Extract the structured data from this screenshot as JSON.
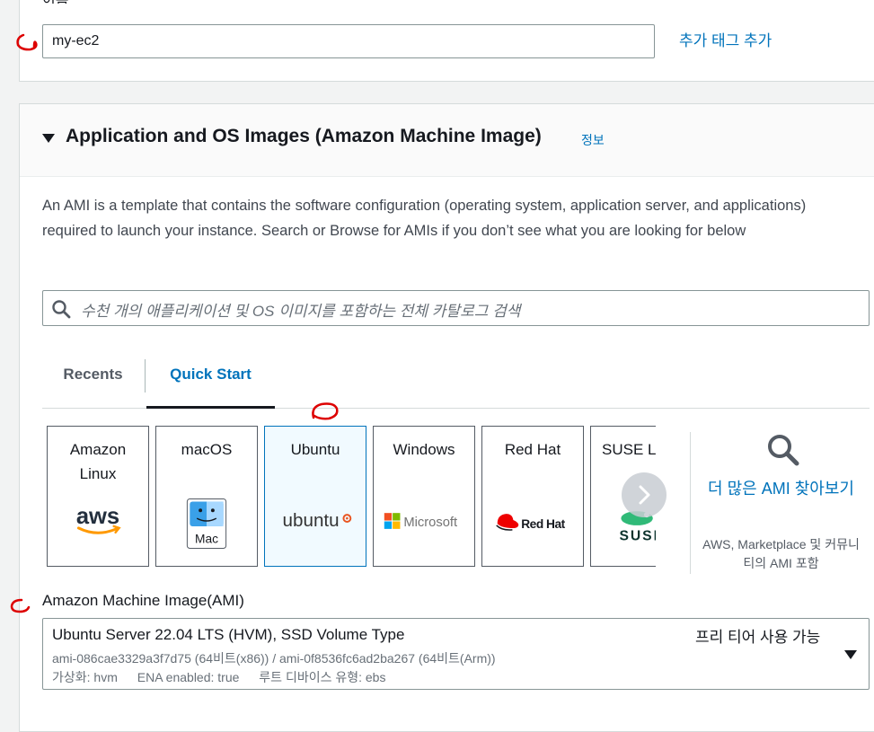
{
  "name_section": {
    "label": "이름",
    "value": "my-ec2",
    "add_tag_link": "추가 태그 추가"
  },
  "ami_section": {
    "title": "Application and OS Images (Amazon Machine Image)",
    "info_link": "정보",
    "description": "An AMI is a template that contains the software configuration (operating system, application server, and applications) required to launch your instance. Search or Browse for AMIs if you don’t see what you are looking for below",
    "search": {
      "placeholder": "수천 개의 애플리케이션 및 OS 이미지를 포함하는 전체 카탈로그 검색",
      "icon": "search-icon"
    },
    "tabs": [
      {
        "label": "Recents",
        "active": false
      },
      {
        "label": "Quick Start",
        "active": true
      }
    ],
    "quick_start_tiles": [
      {
        "name": "Amazon Linux",
        "logo": "aws-logo",
        "selected": false
      },
      {
        "name": "macOS",
        "logo": "mac-finder-logo",
        "logo_text": "Mac",
        "selected": false
      },
      {
        "name": "Ubuntu",
        "logo": "ubuntu-logo",
        "logo_text": "ubuntu",
        "selected": true
      },
      {
        "name": "Windows",
        "logo": "microsoft-logo",
        "logo_text": "Microsoft",
        "selected": false
      },
      {
        "name": "Red Hat",
        "logo": "redhat-logo",
        "logo_text": "Red Hat",
        "selected": false
      },
      {
        "name": "SUSE Li",
        "logo": "suse-logo",
        "logo_text": "SUSE",
        "selected": false
      }
    ],
    "more_amis": {
      "link": "더 많은 AMI 찾아보기",
      "description": "AWS, Marketplace 및 커뮤니티의 AMI 포함"
    },
    "ami_select": {
      "label": "Amazon Machine Image(AMI)",
      "title": "Ubuntu Server 22.04 LTS (HVM), SSD Volume Type",
      "badge": "프리 티어 사용 가능",
      "ids": "ami-086cae3329a3f7d75 (64비트(x86)) / ami-0f8536fc6ad2ba267 (64비트(Arm))",
      "virtualization": "가상화: hvm",
      "ena": "ENA enabled: true",
      "root_device": "루트 디바이스 유형: ebs"
    }
  },
  "colors": {
    "link": "#0073bb",
    "annotation_marker": "#dd0000"
  }
}
